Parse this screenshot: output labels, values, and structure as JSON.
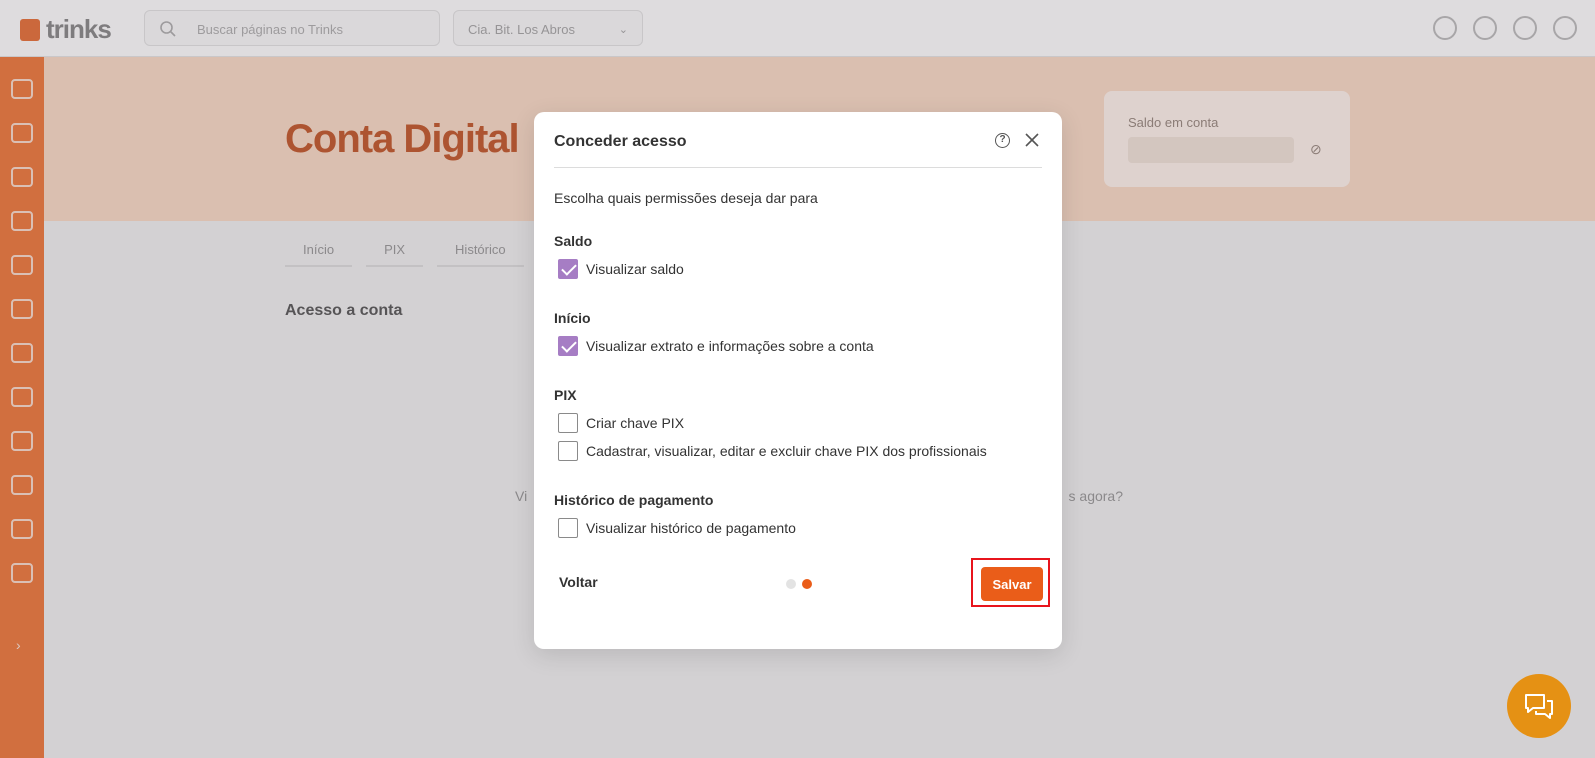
{
  "topbar": {
    "logo_text": "trinks",
    "search_placeholder": "Buscar páginas no Trinks",
    "establishment_select": "Cia. Bit. Los Abros"
  },
  "page": {
    "title": "Conta Digital",
    "balance_label": "Saldo em conta",
    "tabs": [
      {
        "label": "Início"
      },
      {
        "label": "PIX"
      },
      {
        "label": "Histórico"
      }
    ],
    "section_title": "Acesso a conta",
    "background_text_left": "Vi",
    "background_text_right": "s agora?"
  },
  "modal": {
    "title": "Conceder acesso",
    "help_glyph": "?",
    "intro": "Escolha quais permissões deseja dar para",
    "groups": [
      {
        "label": "Saldo",
        "options": [
          {
            "label": "Visualizar saldo",
            "checked": true
          }
        ]
      },
      {
        "label": "Início",
        "options": [
          {
            "label": "Visualizar extrato e informações sobre a conta",
            "checked": true
          }
        ]
      },
      {
        "label": "PIX",
        "options": [
          {
            "label": "Criar chave PIX",
            "checked": false
          },
          {
            "label": "Cadastrar, visualizar, editar e excluir chave PIX dos profissionais",
            "checked": false
          }
        ]
      },
      {
        "label": "Histórico de pagamento",
        "options": [
          {
            "label": "Visualizar histórico de pagamento",
            "checked": false
          }
        ]
      }
    ],
    "back_label": "Voltar",
    "save_label": "Salvar",
    "steps": {
      "total": 2,
      "current": 2
    }
  },
  "colors": {
    "brand_orange": "#ea5d19",
    "sidebar_orange": "#f07a3d",
    "checkbox_purple": "#a67dc4",
    "chat_button": "#e59114",
    "highlight_red": "#e8141c"
  },
  "icons": {
    "search": "search-icon",
    "help": "help-circle-icon",
    "close": "close-icon",
    "chat": "chat-icon",
    "bell": "bell-icon",
    "support": "support-icon",
    "settings": "settings-icon",
    "user": "user-icon"
  }
}
